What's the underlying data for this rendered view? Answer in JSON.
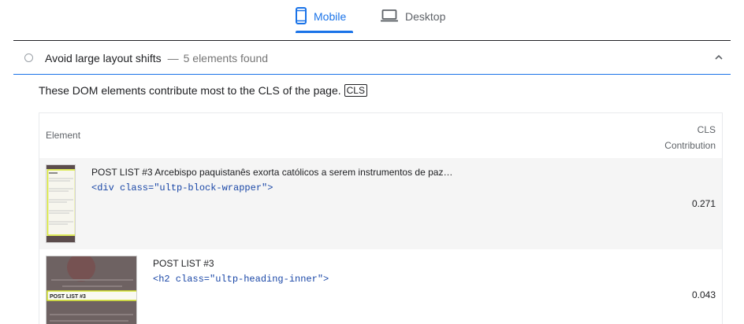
{
  "tabs": [
    {
      "label": "Mobile",
      "icon": "smartphone-icon",
      "active": true
    },
    {
      "label": "Desktop",
      "icon": "laptop-icon",
      "active": false
    }
  ],
  "audit": {
    "title": "Avoid large layout shifts",
    "separator": "—",
    "display_value": "5 elements found",
    "description": "These DOM elements contribute most to the CLS of the page.",
    "badge": "CLS",
    "status_icon": "neutral-circle-icon",
    "expand_icon": "chevron-up-icon"
  },
  "table": {
    "headers": {
      "element": "Element",
      "cls_line1": "CLS",
      "cls_line2": "Contribution"
    },
    "rows": [
      {
        "label": "POST LIST #3 Arcebispo paquistanês exorta católicos a serem instrumentos de paz…",
        "snippet": "<div class=\"ultp-block-wrapper\">",
        "value": "0.271"
      },
      {
        "label": "POST LIST #3",
        "snippet": "<h2 class=\"ultp-heading-inner\">",
        "value": "0.043"
      }
    ]
  },
  "thumbnails": [
    {
      "highlight_text": "POST LIST #3"
    }
  ],
  "colors": {
    "accent": "#1a73e8",
    "code": "#1a47a7",
    "highlight": "#e6f060",
    "row_alt": "#f5f5f5"
  }
}
